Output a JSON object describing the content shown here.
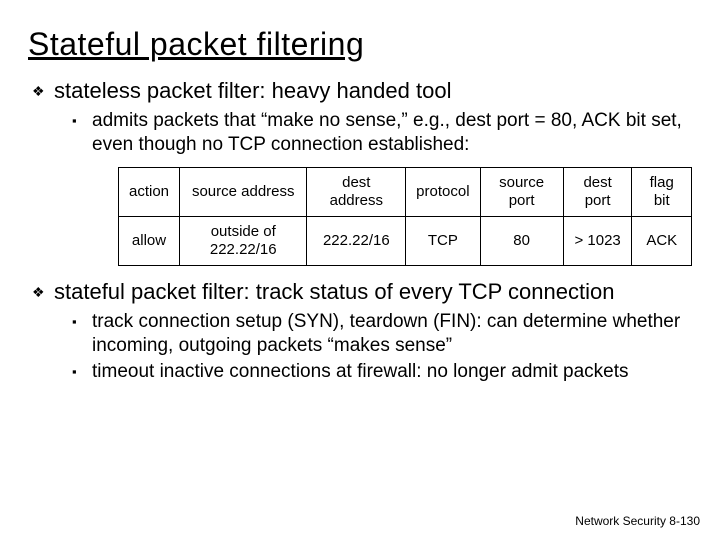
{
  "title": "Stateful packet filtering",
  "bullet1": {
    "glyph": "❖",
    "text": "stateless packet filter: heavy handed tool",
    "sub": [
      "admits packets that “make no sense,” e.g., dest port = 80, ACK bit set, even though no TCP connection established:"
    ]
  },
  "subGlyph": "▪",
  "table": {
    "headers": [
      "action",
      "source address",
      "dest address",
      "protocol",
      "source port",
      "dest port",
      "flag bit"
    ],
    "row": [
      "allow",
      "outside of 222.22/16",
      "222.22/16",
      "TCP",
      "80",
      "> 1023",
      "ACK"
    ]
  },
  "bullet2": {
    "glyph": "❖",
    "text": "stateful packet filter: track status of every TCP connection",
    "sub": [
      "track connection setup (SYN), teardown (FIN): can determine whether incoming, outgoing packets “makes sense”",
      "timeout inactive connections at firewall: no longer admit packets"
    ]
  },
  "footer": "Network Security   8-130"
}
